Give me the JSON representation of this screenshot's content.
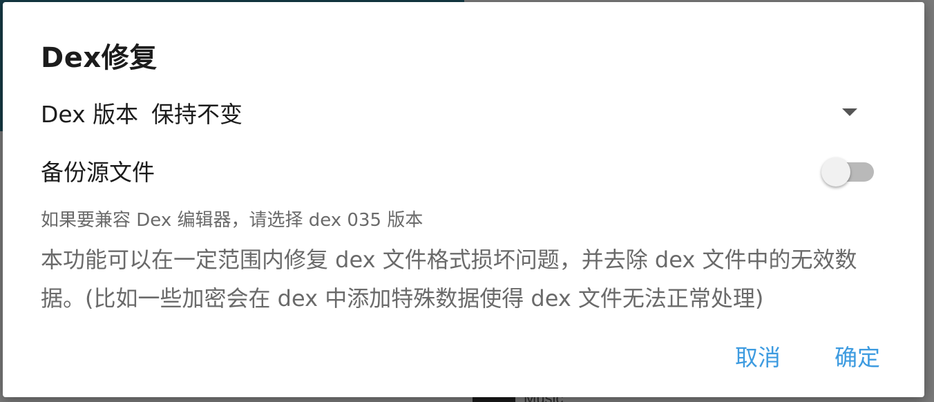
{
  "dialog": {
    "title": "Dex修复",
    "version_label": "Dex 版本",
    "version_value": "保持不变",
    "backup_label": "备份源文件",
    "backup_enabled": false,
    "hint": "如果要兼容 Dex 编辑器，请选择 dex 035 版本",
    "description": "本功能可以在一定范围内修复 dex 文件格式损坏问题，并去除 dex 文件中的无效数据。(比如一些加密会在 dex 中添加特殊数据使得 dex 文件无法正常处理)",
    "cancel_label": "取消",
    "ok_label": "确定",
    "accent_color": "#3d9be0"
  },
  "icons": {
    "dropdown": "dropdown-arrow-icon"
  },
  "background": {
    "partial_text": "Music"
  }
}
